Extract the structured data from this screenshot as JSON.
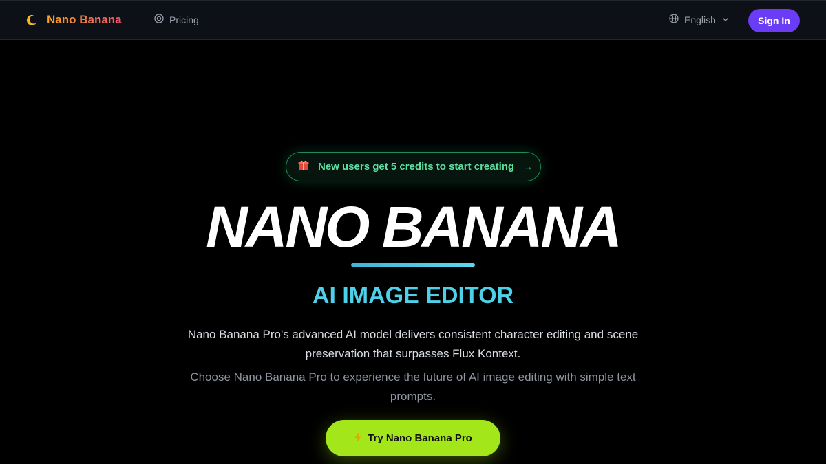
{
  "header": {
    "brand_name": "Nano Banana",
    "brand_icon": "moon-icon",
    "nav": {
      "pricing_label": "Pricing",
      "pricing_icon": "dollar-circle-icon"
    },
    "language": {
      "selected": "English",
      "icon": "globe-icon"
    },
    "signin_label": "Sign In"
  },
  "hero": {
    "promo": {
      "icon": "gift-icon",
      "text": "New users get 5 credits to start creating",
      "arrow": "→"
    },
    "title": "NANO BANANA",
    "subtitle": "AI IMAGE EDITOR",
    "description_1": "Nano Banana Pro's advanced AI model delivers consistent character editing and scene preservation that surpasses Flux Kontext.",
    "description_2": "Choose Nano Banana Pro to experience the future of AI image editing with simple text prompts.",
    "cta": {
      "icon": "lightning-icon",
      "label": "Try Nano Banana Pro"
    }
  },
  "colors": {
    "background": "#000000",
    "header_bg": "#0d1016",
    "accent_purple": "#6b3cf5",
    "accent_green": "#5ee0a0",
    "accent_cyan": "#4dd0e8",
    "cta_lime": "#a3e619"
  }
}
